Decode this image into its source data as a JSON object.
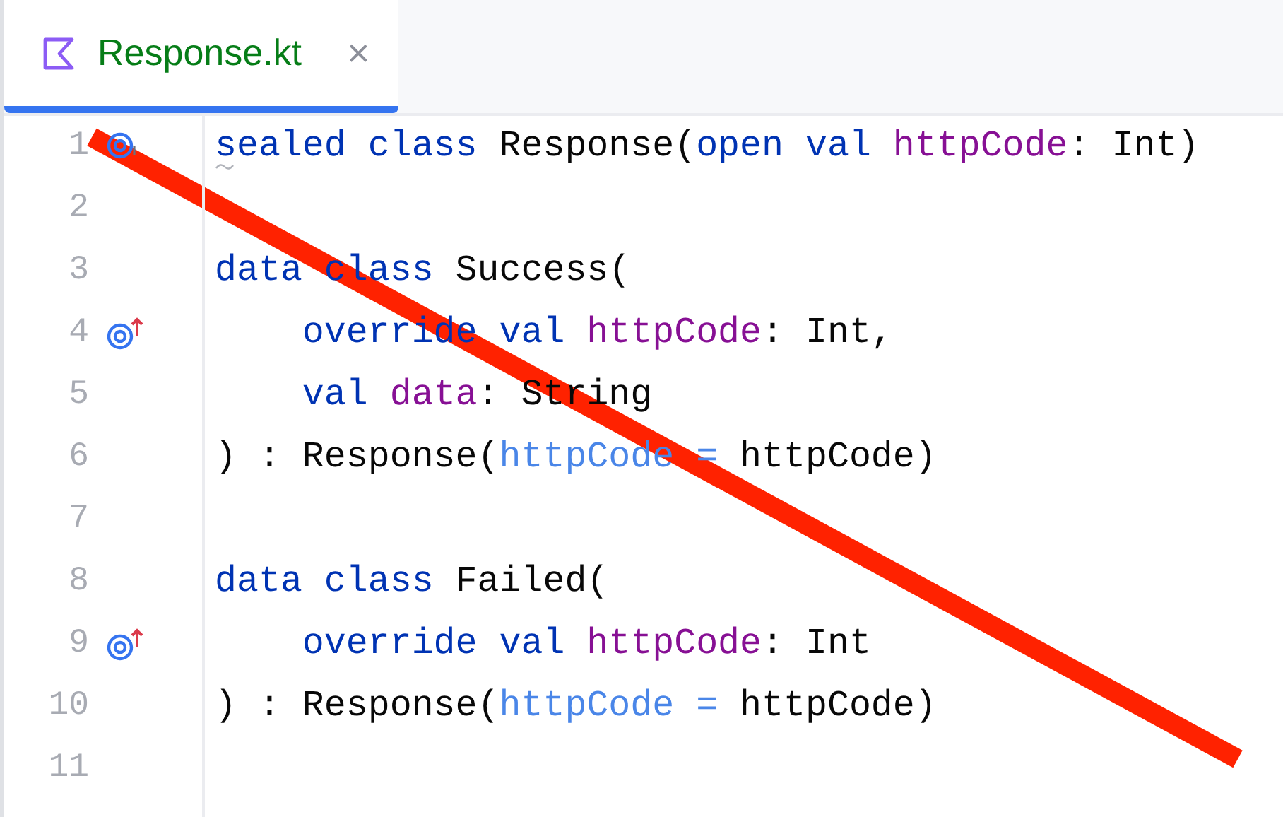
{
  "tabs": [
    {
      "label": "Response.kt",
      "selected": true,
      "close": "×"
    }
  ],
  "lines": [
    {
      "number": "1",
      "kind": "implemented",
      "warning": true,
      "tokens": [
        {
          "kind": "keyword",
          "text": "sealed class "
        },
        {
          "kind": "plain",
          "text": "Response("
        },
        {
          "kind": "keyword",
          "text": "open val "
        },
        {
          "kind": "property",
          "text": "httpCode"
        },
        {
          "kind": "plain",
          "text": ": Int)"
        }
      ]
    },
    {
      "number": "2",
      "kind": "plain",
      "warning": false
    },
    {
      "number": "3",
      "kind": "plain",
      "warning": false,
      "tokens": [
        {
          "kind": "keyword",
          "text": "data class "
        },
        {
          "kind": "plain",
          "text": "Success("
        }
      ]
    },
    {
      "number": "4",
      "kind": "overrides",
      "warning": false,
      "tokens": [
        {
          "kind": "keyword",
          "text": "    override val "
        },
        {
          "kind": "property",
          "text": "httpCode"
        },
        {
          "kind": "plain",
          "text": ": Int,"
        }
      ]
    },
    {
      "number": "5",
      "kind": "plain",
      "warning": false,
      "tokens": [
        {
          "kind": "keyword",
          "text": "    val "
        },
        {
          "kind": "property",
          "text": "data"
        },
        {
          "kind": "plain",
          "text": ": String"
        }
      ]
    },
    {
      "number": "6",
      "kind": "plain",
      "warning": false,
      "tokens": [
        {
          "kind": "plain",
          "text": ") : Response("
        },
        {
          "kind": "param",
          "text": "httpCode = "
        },
        {
          "kind": "plain",
          "text": "httpCode)"
        }
      ]
    },
    {
      "number": "7",
      "kind": "plain",
      "warning": false
    },
    {
      "number": "8",
      "kind": "plain",
      "warning": false,
      "tokens": [
        {
          "kind": "keyword",
          "text": "data class "
        },
        {
          "kind": "plain",
          "text": "Failed("
        }
      ]
    },
    {
      "number": "9",
      "kind": "overrides",
      "warning": false,
      "tokens": [
        {
          "kind": "keyword",
          "text": "    override val "
        },
        {
          "kind": "property",
          "text": "httpCode"
        },
        {
          "kind": "plain",
          "text": ": Int"
        }
      ]
    },
    {
      "number": "10",
      "kind": "plain",
      "warning": false,
      "tokens": [
        {
          "kind": "plain",
          "text": ") : Response("
        },
        {
          "kind": "param",
          "text": "httpCode = "
        },
        {
          "kind": "plain",
          "text": "httpCode)"
        }
      ]
    },
    {
      "number": "11",
      "kind": "plain",
      "warning": false
    }
  ]
}
